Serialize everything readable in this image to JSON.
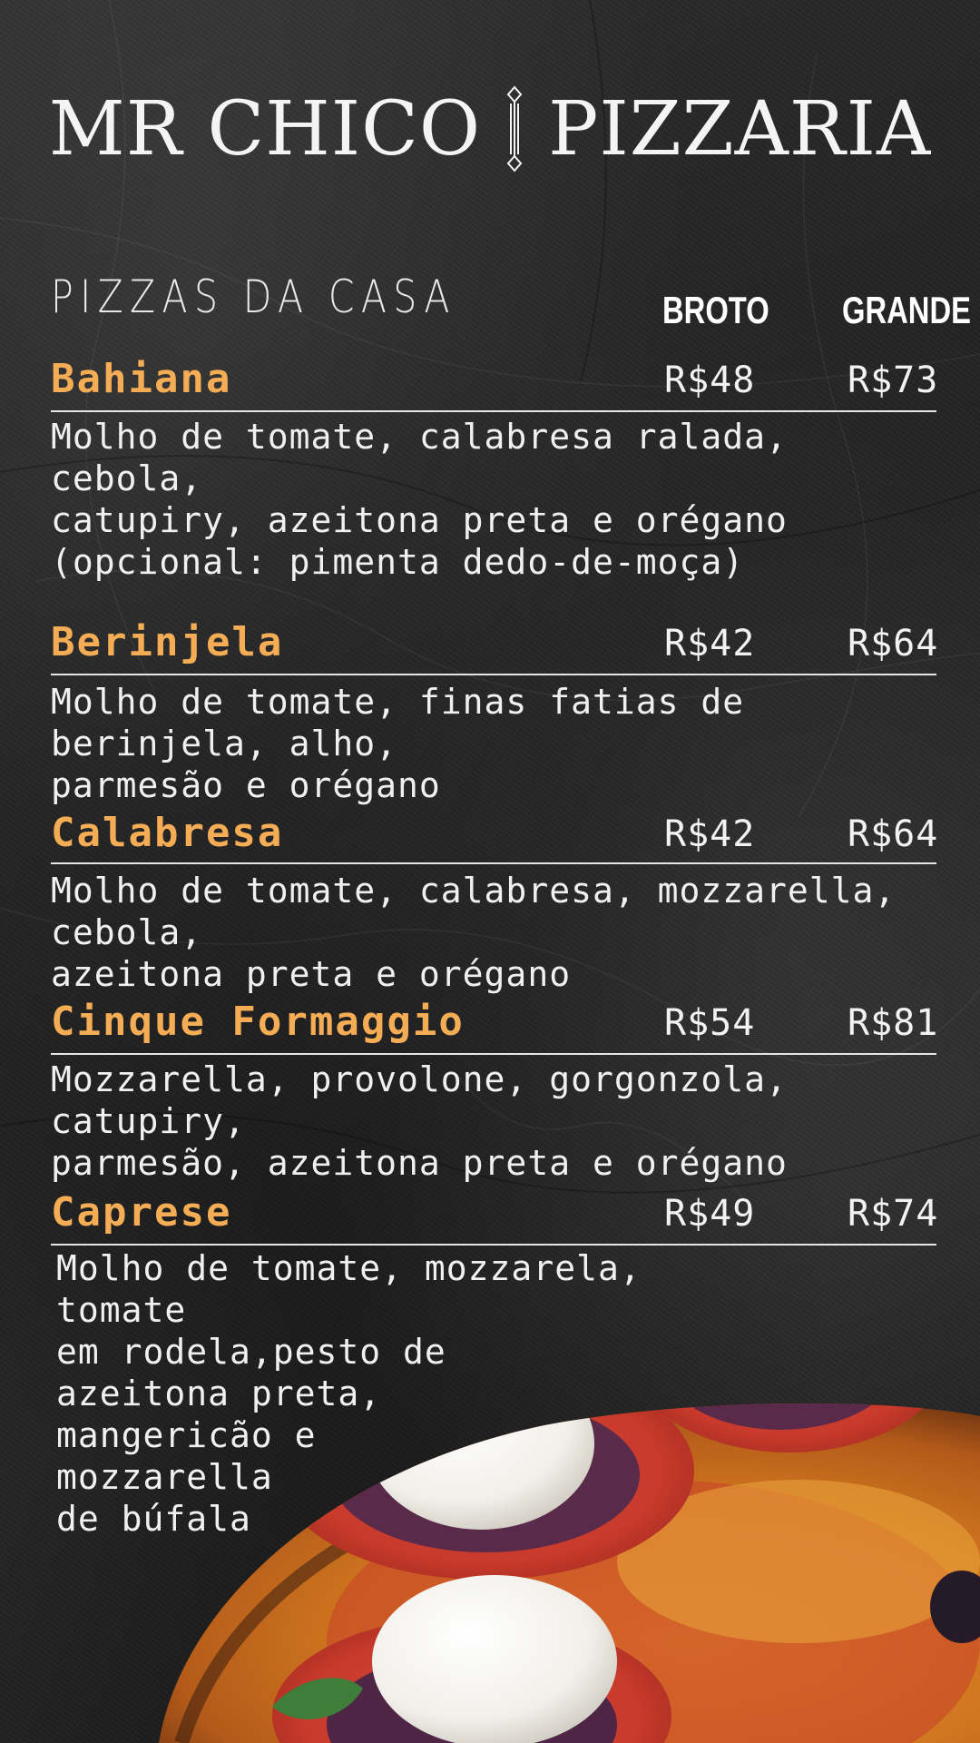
{
  "header": {
    "brand_left": "MR CHICO",
    "brand_right": "PIZZARIA"
  },
  "menu": {
    "section_title": "PIZZAS DA CASA",
    "column_small": "BROTO",
    "column_large": "GRANDE",
    "items": [
      {
        "name": "Bahiana",
        "price_broto": "R$48",
        "price_grande": "R$73",
        "description": "Molho de tomate, calabresa ralada, cebola,\ncatupiry, azeitona preta e orégano\n(opcional: pimenta dedo-de-moça)"
      },
      {
        "name": "Berinjela",
        "price_broto": "R$42",
        "price_grande": "R$64",
        "description": "Molho de tomate, finas fatias de berinjela, alho,\nparmesão e orégano"
      },
      {
        "name": "Calabresa",
        "price_broto": "R$42",
        "price_grande": "R$64",
        "description": "Molho de tomate, calabresa, mozzarella, cebola,\nazeitona preta e orégano"
      },
      {
        "name": "Cinque Formaggio",
        "price_broto": "R$54",
        "price_grande": "R$81",
        "description": "Mozzarella, provolone, gorgonzola, catupiry,\nparmesão, azeitona preta e orégano"
      },
      {
        "name": "Caprese",
        "price_broto": "R$49",
        "price_grande": "R$74",
        "description": "Molho de tomate, mozzarela, tomate\nem rodela,pesto de\n azeitona preta,\nmangericão e\nmozzarella\nde búfala"
      }
    ]
  },
  "colors": {
    "background": "#262626",
    "accent_name": "#f5ad55",
    "text": "#f0f0f0"
  },
  "icons": {
    "title_separator": "ornament-divider-icon",
    "photo": "caprese-pizza-photo"
  }
}
